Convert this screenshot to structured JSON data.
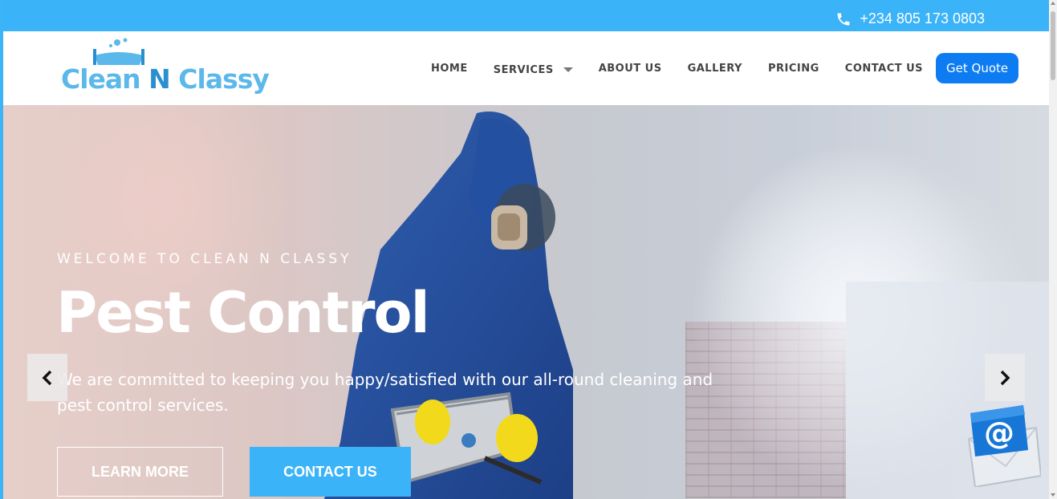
{
  "topbar": {
    "phone": "+234 805 173 0803",
    "icon": "phone-icon"
  },
  "brand": {
    "logo_part1": "Clean ",
    "logo_part2": "N",
    "logo_part3": " Classy"
  },
  "nav": {
    "items": [
      "HOME",
      "SERVICES",
      "ABOUT US",
      "GALLERY",
      "PRICING",
      "CONTACT US"
    ],
    "cta": "Get Quote"
  },
  "hero": {
    "kicker": "WELCOME TO CLEAN N CLASSY",
    "title": "Pest Control",
    "description": "We are committed to keeping you happy/satisfied with our all-round cleaning and pest control services.",
    "btn_learn": "LEARN MORE",
    "btn_contact": "CONTACT US"
  },
  "colors": {
    "accent": "#3bb3f8",
    "cta": "#0d7cf2",
    "logo": "#5bb8ea"
  },
  "icons": {
    "prev": "chevron-left-icon",
    "next": "chevron-right-icon",
    "mail": "email-at-icon"
  }
}
